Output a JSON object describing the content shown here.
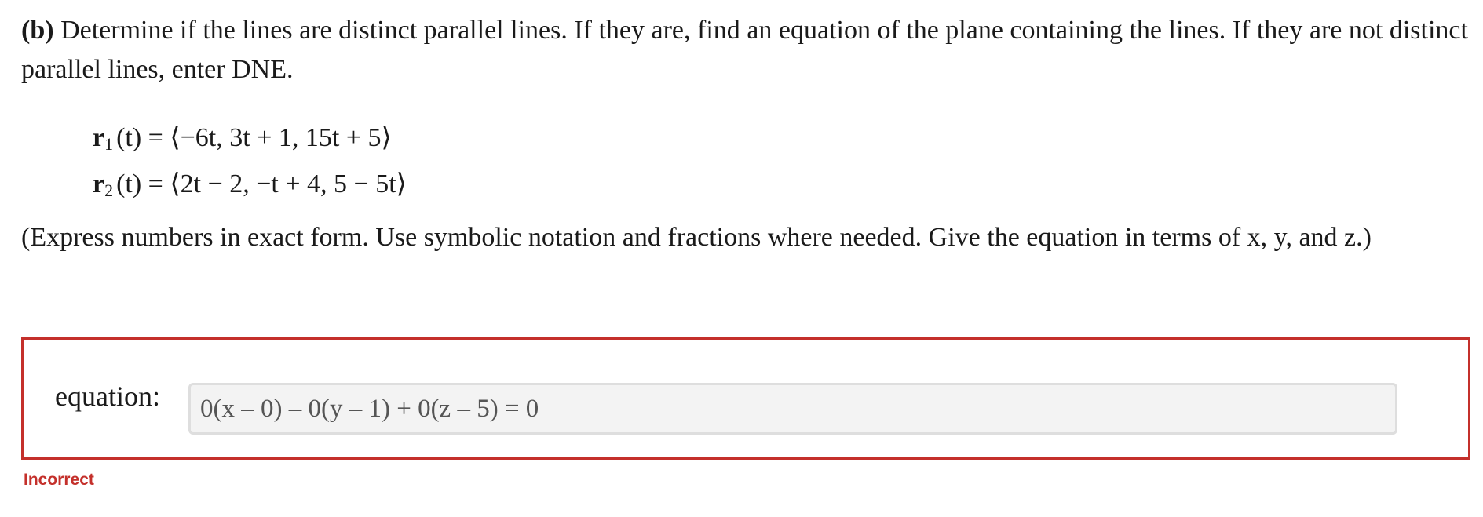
{
  "question": {
    "part_label": "(b)",
    "prompt": " Determine if the lines are distinct parallel lines. If they are, find an equation of the plane containing the lines. If they are not distinct parallel lines, enter DNE."
  },
  "equations": [
    {
      "name": "r",
      "sub": "1",
      "rhs": "(t) = ⟨−6t, 3t + 1, 15t + 5⟩"
    },
    {
      "name": "r",
      "sub": "2",
      "rhs": "(t) = ⟨2t − 2, −t + 4, 5 − 5t⟩"
    }
  ],
  "instructions": "(Express numbers in exact form. Use symbolic notation and fractions where needed. Give the equation in terms of x, y, and z.)",
  "answer": {
    "label": "equation:",
    "value": "0(x – 0) – 0(y – 1) + 0(z – 5) = 0"
  },
  "status": {
    "text": "Incorrect",
    "color": "#c4302b"
  }
}
